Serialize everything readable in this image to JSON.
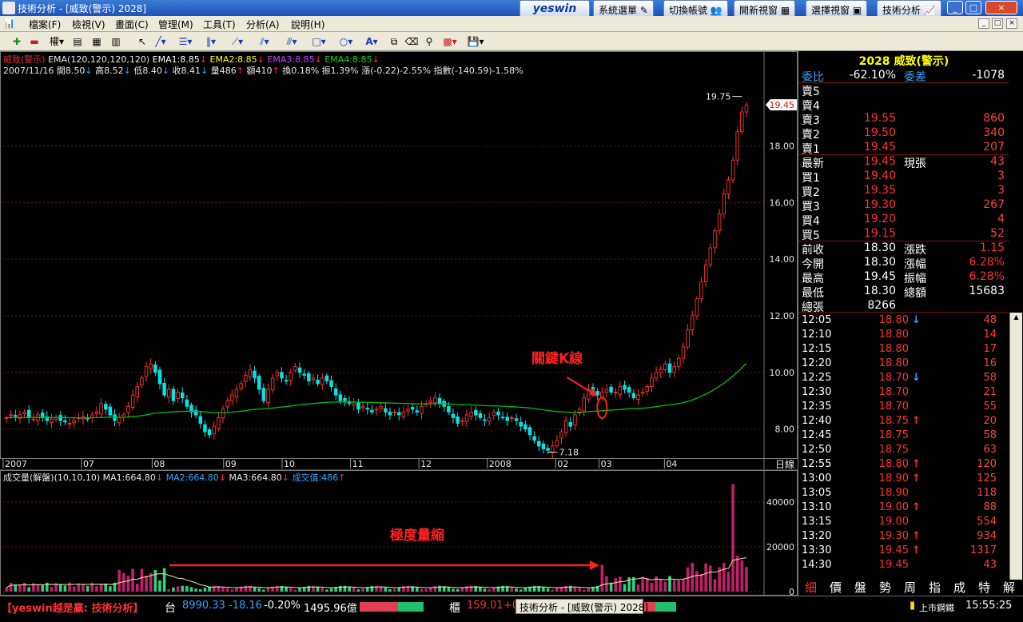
{
  "window": {
    "title": "技術分析 - [威致(警示) 2028]",
    "brand": "yeswin",
    "top_buttons": [
      "系統選單",
      "切換帳號",
      "開新視窗",
      "選擇視窗",
      "技術分析"
    ],
    "controls": [
      "_",
      "□",
      "×"
    ]
  },
  "menu": {
    "items": [
      "檔案(F)",
      "檢視(V)",
      "畫面(C)",
      "管理(M)",
      "工具(T)",
      "分析(A)",
      "說明(H)"
    ],
    "mdi_controls": [
      "_",
      "□",
      "×"
    ]
  },
  "toolbar": {
    "period_label": "權"
  },
  "chart": {
    "legend_line1": {
      "stock": "威致(警示)",
      "ema": "EMA(120,120,120,120)",
      "ema1": "EMA1:8.85",
      "ema2": "EMA2:8.85",
      "ema3": "EMA3:8.85",
      "ema4": "EMA4:8.85"
    },
    "legend_line2": {
      "date": "2007/11/16",
      "open": "開8.50",
      "high": "高8.52",
      "low": "低8.40",
      "close": "收8.41",
      "volume": "量486",
      "amount": "額410",
      "turnover": "換0.18%",
      "amplitude": "振1.39%",
      "change": "漲(-0.22)-2.55%",
      "index": "指數(-140.59)-1.58%"
    },
    "price_labels": [
      "18.00",
      "16.00",
      "14.00",
      "12.00",
      "10.00",
      "8.00"
    ],
    "current_price_tag": "19.45",
    "high_label": "19.75",
    "low_label": "7.18",
    "month_labels": [
      "2007",
      "07",
      "08",
      "09",
      "10",
      "11",
      "12",
      "2008",
      "02",
      "03",
      "04"
    ],
    "period_tag": "日線",
    "annotation_key": "關鍵K線",
    "annotation_volume": "極度量縮",
    "volume_legend": {
      "name": "成交量(解盤)(10,10,10)",
      "ma1": "MA1:664.80",
      "ma2": "MA2:664.80",
      "ma3": "MA3:664.80",
      "value": "成交值:486"
    },
    "volume_labels": [
      "40000",
      "20000",
      "0"
    ]
  },
  "chart_data": {
    "type": "candlestick",
    "title": "威致(警示)",
    "price_ylim": [
      7,
      20.5
    ],
    "volume_ylim": [
      0,
      50000
    ],
    "ema_period": 120,
    "price_series": {
      "name": "威致(警示)",
      "closes": [
        8.4,
        8.5,
        8.45,
        8.5,
        8.6,
        8.4,
        8.35,
        8.5,
        8.4,
        8.3,
        8.35,
        8.4,
        8.3,
        8.25,
        8.2,
        8.3,
        8.4,
        8.45,
        8.35,
        8.5,
        8.6,
        8.9,
        8.7,
        8.5,
        8.3,
        8.4,
        8.5,
        8.8,
        9.2,
        9.5,
        9.8,
        10.2,
        10.3,
        10.0,
        9.6,
        9.2,
        9.4,
        9.0,
        9.3,
        9.1,
        8.8,
        8.6,
        8.5,
        8.2,
        7.9,
        7.8,
        8.1,
        8.4,
        8.7,
        9.0,
        9.2,
        9.4,
        9.6,
        9.9,
        10.1,
        9.8,
        9.4,
        9.0,
        9.4,
        9.8,
        10.0,
        9.8,
        9.7,
        10.0,
        10.2,
        10.0,
        9.9,
        9.7,
        9.8,
        9.6,
        9.8,
        9.7,
        9.5,
        9.2,
        9.0,
        9.0,
        8.9,
        8.9,
        8.7,
        8.8,
        8.7,
        8.6,
        8.7,
        8.8,
        8.6,
        8.5,
        8.6,
        8.5,
        8.6,
        8.7,
        8.7,
        8.6,
        8.8,
        8.9,
        9.0,
        9.1,
        8.9,
        8.8,
        8.6,
        8.4,
        8.2,
        8.3,
        8.5,
        8.6,
        8.5,
        8.4,
        8.3,
        8.4,
        8.6,
        8.5,
        8.4,
        8.3,
        8.4,
        8.3,
        8.1,
        8.0,
        7.8,
        7.6,
        7.4,
        7.3,
        7.25,
        7.4,
        7.6,
        7.9,
        8.3,
        8.1,
        8.5,
        8.7,
        9.1,
        9.4,
        9.3,
        9.2,
        9.3,
        9.4,
        9.3,
        9.3,
        9.5,
        9.4,
        9.3,
        9.1,
        9.2,
        9.3,
        9.5,
        9.8,
        10.0,
        10.1,
        10.3,
        10.0,
        10.2,
        10.5,
        10.9,
        11.5,
        12.0,
        12.6,
        13.2,
        13.8,
        14.4,
        15.0,
        15.6,
        16.3,
        16.8,
        17.5,
        18.5,
        19.2,
        19.45
      ]
    },
    "volume_series": {
      "name": "成交量",
      "ma": [
        664.8,
        664.8,
        664.8
      ]
    }
  },
  "quote": {
    "header": "2028 威致(警示)",
    "ratio_label": "委比",
    "ratio_value": "-62.10%",
    "diff_label": "委差",
    "diff_value": "-1078",
    "asks": [
      {
        "label": "賣5",
        "price": "",
        "vol": ""
      },
      {
        "label": "賣4",
        "price": "",
        "vol": ""
      },
      {
        "label": "賣3",
        "price": "19.55",
        "vol": "860"
      },
      {
        "label": "賣2",
        "price": "19.50",
        "vol": "340"
      },
      {
        "label": "賣1",
        "price": "19.45",
        "vol": "207"
      }
    ],
    "last": {
      "label": "最新",
      "price": "19.45",
      "label2": "現張",
      "vol": "43"
    },
    "bids": [
      {
        "label": "買1",
        "price": "19.40",
        "vol": "3"
      },
      {
        "label": "買2",
        "price": "19.35",
        "vol": "3"
      },
      {
        "label": "買3",
        "price": "19.30",
        "vol": "267"
      },
      {
        "label": "買4",
        "price": "19.20",
        "vol": "4"
      },
      {
        "label": "買5",
        "price": "19.15",
        "vol": "52"
      }
    ],
    "stats": [
      {
        "l1": "前收",
        "v1": "18.30",
        "l2": "漲跌",
        "v2": "1.15"
      },
      {
        "l1": "今開",
        "v1": "18.30",
        "l2": "漲幅",
        "v2": "6.28%"
      },
      {
        "l1": "最高",
        "v1": "19.45",
        "l2": "振幅",
        "v2": "6.28%"
      },
      {
        "l1": "最低",
        "v1": "18.30",
        "l2": "總額",
        "v2": "15683"
      },
      {
        "l1": "總張",
        "v1": "8266",
        "l2": "",
        "v2": ""
      }
    ],
    "ticks": [
      {
        "time": "12:05",
        "price": "18.80",
        "arrow": "↓",
        "vol": "48"
      },
      {
        "time": "12:10",
        "price": "18.80",
        "arrow": "",
        "vol": "14"
      },
      {
        "time": "12:15",
        "price": "18.80",
        "arrow": "",
        "vol": "17"
      },
      {
        "time": "12:20",
        "price": "18.80",
        "arrow": "",
        "vol": "16"
      },
      {
        "time": "12:25",
        "price": "18.70",
        "arrow": "↓",
        "vol": "58"
      },
      {
        "time": "12:30",
        "price": "18.70",
        "arrow": "",
        "vol": "21"
      },
      {
        "time": "12:35",
        "price": "18.70",
        "arrow": "",
        "vol": "55"
      },
      {
        "time": "12:40",
        "price": "18.75",
        "arrow": "↑",
        "vol": "20"
      },
      {
        "time": "12:45",
        "price": "18.75",
        "arrow": "",
        "vol": "58"
      },
      {
        "time": "12:50",
        "price": "18.75",
        "arrow": "",
        "vol": "63"
      },
      {
        "time": "12:55",
        "price": "18.80",
        "arrow": "↑",
        "vol": "120"
      },
      {
        "time": "13:00",
        "price": "18.90",
        "arrow": "↑",
        "vol": "125"
      },
      {
        "time": "13:05",
        "price": "18.90",
        "arrow": "",
        "vol": "118"
      },
      {
        "time": "13:10",
        "price": "19.00",
        "arrow": "↑",
        "vol": "88"
      },
      {
        "time": "13:15",
        "price": "19.00",
        "arrow": "",
        "vol": "554"
      },
      {
        "time": "13:20",
        "price": "19.30",
        "arrow": "↑",
        "vol": "934"
      },
      {
        "time": "13:30",
        "price": "19.45",
        "arrow": "↑",
        "vol": "1317"
      },
      {
        "time": "14:30",
        "price": "19.45",
        "arrow": "",
        "vol": "43"
      }
    ],
    "tabs": [
      "細",
      "價",
      "盤",
      "勢",
      "周",
      "指",
      "成",
      "特",
      "解"
    ]
  },
  "status": {
    "brand": "【yeswin越是贏: 技術分析】",
    "market": "台",
    "index_value": "8990.33",
    "index_change": "-18.16",
    "index_pct": "-0.20%",
    "amount": "1495.96億",
    "otc_label": "櫃",
    "otc_value": "159.01",
    "otc_change": "+0",
    "taskbar_item": "技術分析 - [威致(警示) 2028]",
    "right_label": "上市鋼鐵",
    "clock": "15:55:25"
  },
  "colors": {
    "up": "#ff3030",
    "down": "#00e5e5",
    "ema": "#00c000",
    "grid": "#7a1010",
    "axis_text": "#e8e8e8",
    "highlight": "#ffff00"
  }
}
